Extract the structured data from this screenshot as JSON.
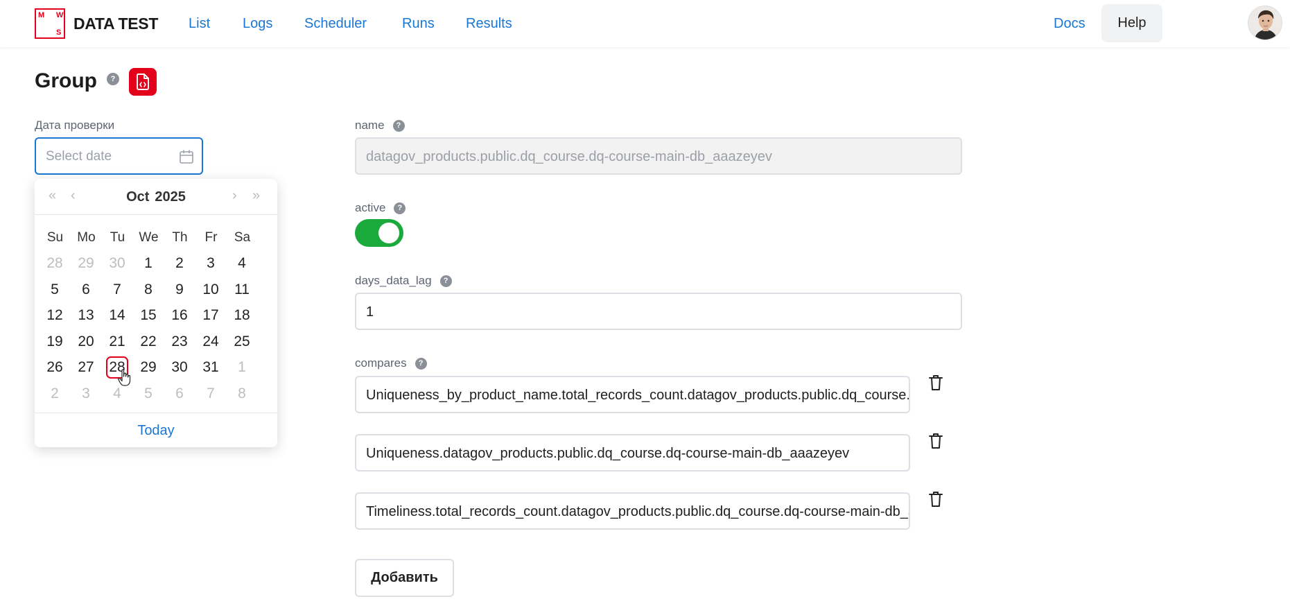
{
  "header": {
    "logo_letters": [
      "M",
      "W",
      "S"
    ],
    "brand": "DATA TEST",
    "nav": [
      "List",
      "Logs",
      "Scheduler",
      "Runs",
      "Results"
    ],
    "docs": "Docs",
    "help": "Help"
  },
  "page": {
    "title": "Group",
    "help_mark": "?"
  },
  "date_filter": {
    "label": "Дата проверки",
    "placeholder": "Select date"
  },
  "calendar": {
    "month": "Oct",
    "year": "2025",
    "nav": {
      "prev_year": "«",
      "prev_month": "‹",
      "next_month": "›",
      "next_year": "»"
    },
    "weekdays": [
      "Su",
      "Mo",
      "Tu",
      "We",
      "Th",
      "Fr",
      "Sa"
    ],
    "weeks": [
      [
        "28",
        "29",
        "30",
        "1",
        "2",
        "3",
        "4"
      ],
      [
        "5",
        "6",
        "7",
        "8",
        "9",
        "10",
        "11"
      ],
      [
        "12",
        "13",
        "14",
        "15",
        "16",
        "17",
        "18"
      ],
      [
        "19",
        "20",
        "21",
        "22",
        "23",
        "24",
        "25"
      ],
      [
        "26",
        "27",
        "28",
        "29",
        "30",
        "31",
        "1"
      ],
      [
        "2",
        "3",
        "4",
        "5",
        "6",
        "7",
        "8"
      ]
    ],
    "today_label": "Today",
    "today_day": "28"
  },
  "form": {
    "name": {
      "label": "name",
      "value": "datagov_products.public.dq_course.dq-course-main-db_aaazeyev"
    },
    "active": {
      "label": "active",
      "checked": true
    },
    "days_data_lag": {
      "label": "days_data_lag",
      "value": "1"
    },
    "compares": {
      "label": "compares",
      "items": [
        "Uniqueness_by_product_name.total_records_count.datagov_products.public.dq_course.dq-course-main-db_aaazeyev",
        "Uniqueness.datagov_products.public.dq_course.dq-course-main-db_aaazeyev",
        "Timeliness.total_records_count.datagov_products.public.dq_course.dq-course-main-db_aaazeyev"
      ]
    },
    "add_button": "Добавить"
  },
  "colors": {
    "brand_red": "#e3001b",
    "link_blue": "#1877d4",
    "toggle_green": "#1aaa3b"
  }
}
